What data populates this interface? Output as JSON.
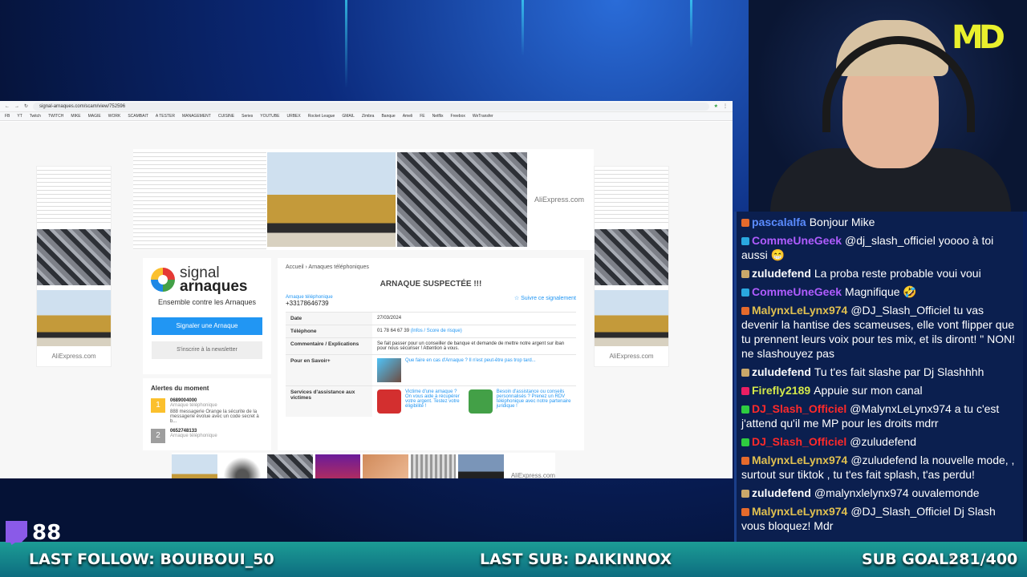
{
  "browser": {
    "url": "signal-arnaques.com/scam/view/752596",
    "bookmarks": [
      "FB",
      "YT",
      "Twitch",
      "TWITCH",
      "MIKE",
      "MAGIE",
      "WORK",
      "SCAMBAIT",
      "A TESTER",
      "MANAGEMENT",
      "CUISINE",
      "Series",
      "YOUTUBE",
      "URBEX",
      "Rocket League",
      "GMAIL",
      "Zimbra",
      "Banque",
      "Ameli",
      "FE",
      "Netflix",
      "Freebox",
      "WeTransfer"
    ]
  },
  "ads": {
    "label": "AliExpress.com"
  },
  "site": {
    "logo_line1": "signal",
    "logo_line2": "arnaques",
    "tagline": "Ensemble contre les Arnaques",
    "report_button": "Signaler une Arnaque",
    "newsletter_button": "S'inscrire à la newsletter"
  },
  "alerts": {
    "title": "Alertes du moment",
    "items": [
      {
        "rank": "1",
        "number": "0689004000",
        "category": "Arnaque téléphonique",
        "desc": "888 messagerie Orange la sécurite de la messagerie évolue avec un code secret à b...",
        "color": "#fbc02d"
      },
      {
        "rank": "2",
        "number": "0652748133",
        "category": "Arnaque téléphonique",
        "color": "#9e9e9e"
      }
    ]
  },
  "report": {
    "breadcrumb": "Accueil › Arnaques téléphoniques",
    "title": "ARNAQUE SUSPECTÉE !!!",
    "type_link": "Arnaque téléphonique",
    "phone": "+33178646739",
    "follow": "☆ Suivre ce signalement",
    "rows": [
      {
        "key": "Date",
        "value": "27/03/2024"
      },
      {
        "key": "Téléphone",
        "value": "01 78 64 67 39",
        "extra": "(Infos / Score de risque)"
      },
      {
        "key": "Commentaire / Explications",
        "value": "Se fait passer pour un conseiller de banque et demande de mettre notre argent sur iban pour nous sécuriser ! Attention à vous."
      },
      {
        "key": "Pour en Savoir+",
        "value": "Que faire en cas d'Arnaque ? Il n'est peut-être pas trop tard..."
      },
      {
        "key": "Services d'assistance aux victimes",
        "value": "Victime d'une arnaque ? On vous aide à récupérer votre argent. Testez votre éligibilité !",
        "value2": "Besoin d'assistance ou conseils personnalisés ? Prenez un RDV téléphonique avec notre partenaire juridique !"
      }
    ]
  },
  "chat": [
    {
      "user": "pascalalfa",
      "color": "#5b8cff",
      "text": "Bonjour Mike"
    },
    {
      "user": "CommeUneGeek",
      "color": "#b05cff",
      "text": "@dj_slash_officiel yoooo à toi aussi 😁"
    },
    {
      "user": "zuludefend",
      "color": "#ffffff",
      "text": "La proba reste probable voui voui"
    },
    {
      "user": "CommeUneGeek",
      "color": "#b05cff",
      "text": "Magnifique 🤣"
    },
    {
      "user": "MalynxLeLynx974",
      "color": "#e0c050",
      "text": "@DJ_Slash_Officiel tu vas devenir la hantise des scameuses, elle vont flipper que tu prennent leurs voix pour tes mix, et ils diront! \" NON! ne slashouyez pas"
    },
    {
      "user": "zuludefend",
      "color": "#ffffff",
      "text": "Tu t'es fait slashe par Dj Slashhhh"
    },
    {
      "user": "Firefly2189",
      "color": "#d4e84a",
      "text": "Appuie sur mon canal"
    },
    {
      "user": "DJ_Slash_Officiel",
      "color": "#ff2a2a",
      "text": "@MalynxLeLynx974 a tu c'est j'attend qu'il me MP pour les droits mdrr"
    },
    {
      "user": "DJ_Slash_Officiel",
      "color": "#ff2a2a",
      "text": "@zuludefend"
    },
    {
      "user": "MalynxLeLynx974",
      "color": "#e0c050",
      "text": "@zuludefend la nouvelle mode, , surtout sur tiktok , tu t'es fait splash, t'as perdu!"
    },
    {
      "user": "zuludefend",
      "color": "#ffffff",
      "text": "@malynxlelynx974 ouvalemonde"
    },
    {
      "user": "MalynxLeLynx974",
      "color": "#e0c050",
      "text": "@DJ_Slash_Officiel Dj Slash vous bloquez! Mdr"
    }
  ],
  "overlay": {
    "viewers": "88",
    "last_follow": "LAST FOLLOW: BOUIBOUI_50",
    "last_sub": "LAST SUB: DAIKINNOX",
    "sub_goal": "SUB GOAL:",
    "sub_goal_value": "281/400",
    "logo": "MD"
  }
}
